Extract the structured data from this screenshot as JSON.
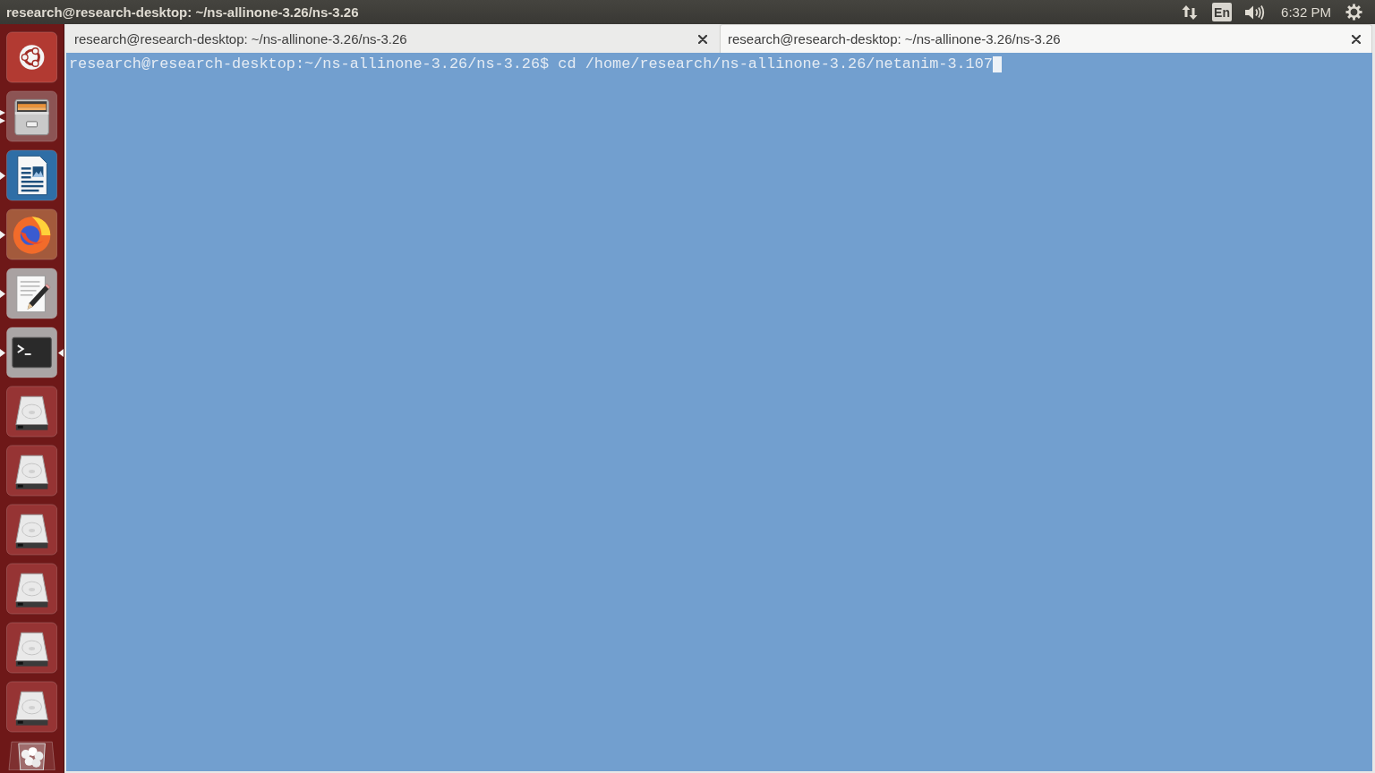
{
  "top_bar": {
    "title": "research@research-desktop: ~/ns-allinone-3.26/ns-3.26",
    "keyboard_layout": "En",
    "clock": "6:32 PM"
  },
  "launcher": {
    "items": [
      {
        "kind": "dash",
        "running": false,
        "multiple_windows": false,
        "focused": false
      },
      {
        "kind": "files",
        "running": true,
        "multiple_windows": true,
        "focused": false
      },
      {
        "kind": "writer",
        "running": true,
        "multiple_windows": false,
        "focused": false
      },
      {
        "kind": "browser",
        "running": true,
        "multiple_windows": false,
        "focused": false
      },
      {
        "kind": "editor",
        "running": true,
        "multiple_windows": false,
        "focused": false
      },
      {
        "kind": "terminal",
        "running": true,
        "multiple_windows": false,
        "focused": true
      },
      {
        "kind": "drive",
        "running": false,
        "multiple_windows": false,
        "focused": false
      },
      {
        "kind": "drive",
        "running": false,
        "multiple_windows": false,
        "focused": false
      },
      {
        "kind": "drive",
        "running": false,
        "multiple_windows": false,
        "focused": false
      },
      {
        "kind": "drive",
        "running": false,
        "multiple_windows": false,
        "focused": false
      },
      {
        "kind": "drive",
        "running": false,
        "multiple_windows": false,
        "focused": false
      },
      {
        "kind": "drive",
        "running": false,
        "multiple_windows": false,
        "focused": false
      },
      {
        "kind": "trash",
        "running": false,
        "multiple_windows": false,
        "focused": false
      }
    ]
  },
  "terminal": {
    "tabs": [
      {
        "title": "research@research-desktop: ~/ns-allinone-3.26/ns-3.26",
        "selected": false
      },
      {
        "title": "research@research-desktop: ~/ns-allinone-3.26/ns-3.26",
        "selected": true
      }
    ],
    "lines": [
      {
        "text": "research@research-desktop:~/ns-allinone-3.26/ns-3.26$ cd /home/research/ns-allinone-3.26/netanim-3.107",
        "cursor": true
      }
    ]
  }
}
